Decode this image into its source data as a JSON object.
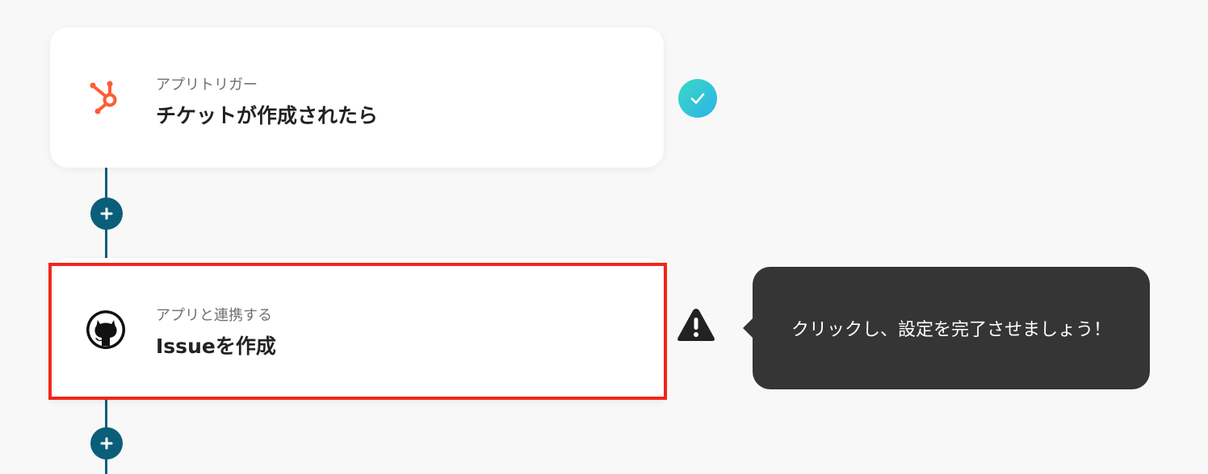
{
  "flow": {
    "steps": [
      {
        "app_icon": "hubspot-icon",
        "label": "アプリトリガー",
        "title": "チケットが作成されたら",
        "status": "completed",
        "status_icon": "check-icon"
      },
      {
        "app_icon": "github-icon",
        "label": "アプリと連携する",
        "title": "Issueを作成",
        "status": "warning",
        "status_icon": "warning-icon"
      }
    ],
    "add_step_icon": "plus-icon"
  },
  "tooltip": {
    "text": "クリックし、設定を完了させましょう！"
  },
  "colors": {
    "connector": "#0b5e7a",
    "hubspot": "#ff5c35",
    "highlight_border": "#f2261b",
    "tooltip_bg": "#353535",
    "check_gradient_start": "#3ad8c6",
    "check_gradient_end": "#2cb3e6"
  }
}
